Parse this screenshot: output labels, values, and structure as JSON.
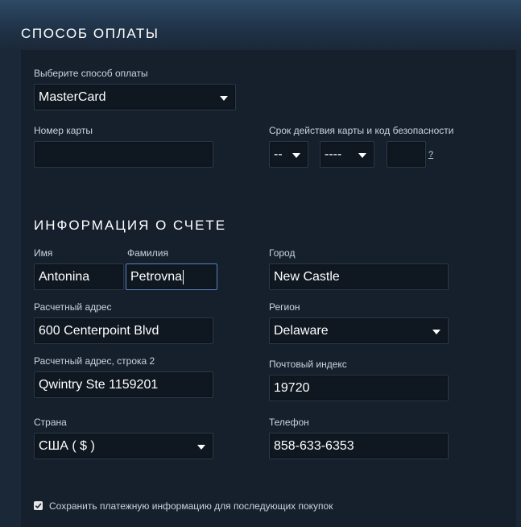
{
  "payment": {
    "title": "СПОСОБ ОПЛАТЫ",
    "method_label": "Выберите способ оплаты",
    "method_value": "MasterCard",
    "card_number_label": "Номер карты",
    "card_number_value": "",
    "expiry_label": "Срок действия карты и код безопасности",
    "expiry_month": "--",
    "expiry_year": "----",
    "security_code": "",
    "help_link": "?"
  },
  "billing": {
    "title": "ИНФОРМАЦИЯ О СЧЕТЕ",
    "first_name_label": "Имя",
    "first_name": "Antonina",
    "last_name_label": "Фамилия",
    "last_name": "Petrovna",
    "city_label": "Город",
    "city": "New Castle",
    "address_label": "Расчетный адрес",
    "address": "600 Centerpoint Blvd",
    "region_label": "Регион",
    "region": "Delaware",
    "address2_label": "Расчетный адрес, строка 2",
    "address2": "Qwintry Ste 1159201",
    "zip_label": "Почтовый индекс",
    "zip": "19720",
    "country_label": "Страна",
    "country": "США ( $ )",
    "phone_label": "Телефон",
    "phone": "858-633-6353"
  },
  "save_info": {
    "checked": true,
    "label": "Сохранить платежную информацию для последующих покупок"
  }
}
